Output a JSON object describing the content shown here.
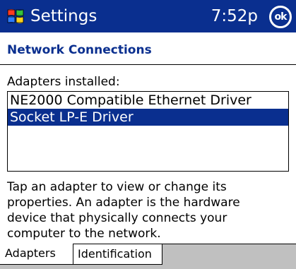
{
  "titlebar": {
    "start_icon": "windows-flag-icon",
    "title": "Settings",
    "time": "7:52p",
    "ok_label": "ok"
  },
  "page": {
    "title": "Network Connections"
  },
  "adapters": {
    "label": "Adapters installed:",
    "items": [
      "NE2000 Compatible Ethernet Driver",
      "Socket LP-E Driver"
    ],
    "selected_index": 1
  },
  "help": {
    "lines": [
      "Tap an adapter to view or change its",
      "properties. An adapter is the hardware",
      "device that physically connects your",
      "computer to the network."
    ]
  },
  "tabs": [
    {
      "label": "Adapters",
      "active": true
    },
    {
      "label": "Identification",
      "active": false
    }
  ],
  "colors": {
    "titlebar_bg": "#0a2f8f",
    "selection_bg": "#0a2f8f",
    "tabbar_bg": "#c0c0c0"
  }
}
